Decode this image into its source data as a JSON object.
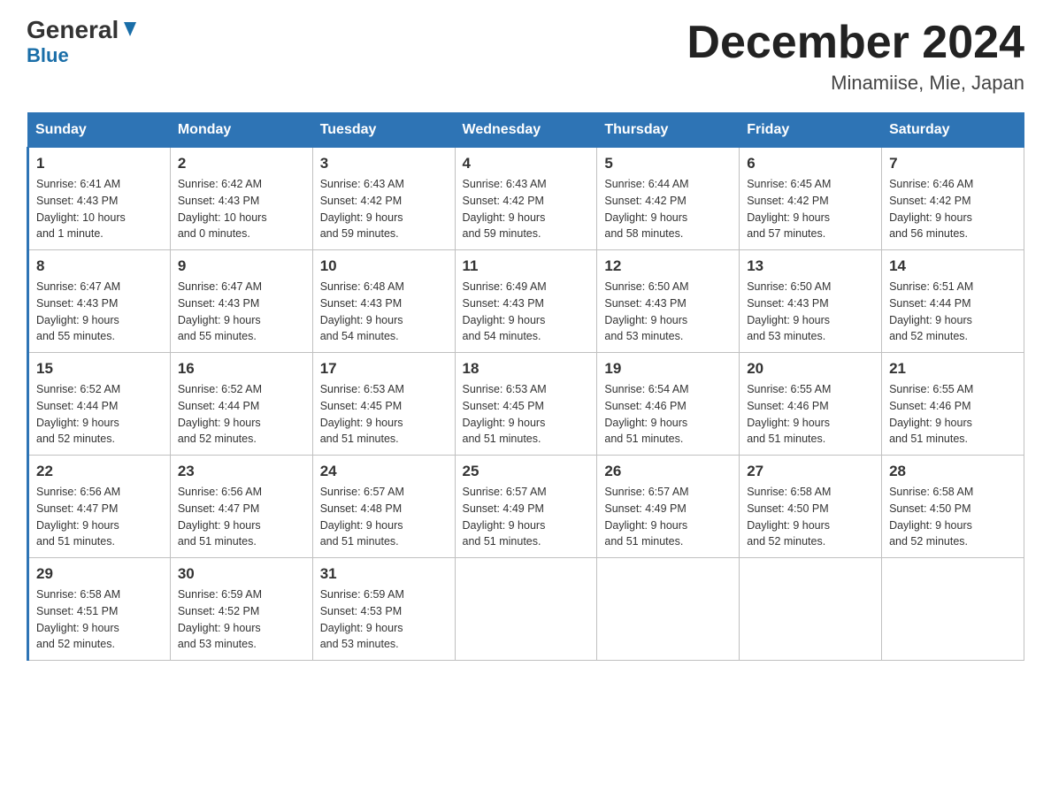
{
  "logo": {
    "part1": "General",
    "part2": "Blue"
  },
  "title": "December 2024",
  "subtitle": "Minamiise, Mie, Japan",
  "days_header": [
    "Sunday",
    "Monday",
    "Tuesday",
    "Wednesday",
    "Thursday",
    "Friday",
    "Saturday"
  ],
  "weeks": [
    [
      {
        "day": "1",
        "info": "Sunrise: 6:41 AM\nSunset: 4:43 PM\nDaylight: 10 hours\nand 1 minute."
      },
      {
        "day": "2",
        "info": "Sunrise: 6:42 AM\nSunset: 4:43 PM\nDaylight: 10 hours\nand 0 minutes."
      },
      {
        "day": "3",
        "info": "Sunrise: 6:43 AM\nSunset: 4:42 PM\nDaylight: 9 hours\nand 59 minutes."
      },
      {
        "day": "4",
        "info": "Sunrise: 6:43 AM\nSunset: 4:42 PM\nDaylight: 9 hours\nand 59 minutes."
      },
      {
        "day": "5",
        "info": "Sunrise: 6:44 AM\nSunset: 4:42 PM\nDaylight: 9 hours\nand 58 minutes."
      },
      {
        "day": "6",
        "info": "Sunrise: 6:45 AM\nSunset: 4:42 PM\nDaylight: 9 hours\nand 57 minutes."
      },
      {
        "day": "7",
        "info": "Sunrise: 6:46 AM\nSunset: 4:42 PM\nDaylight: 9 hours\nand 56 minutes."
      }
    ],
    [
      {
        "day": "8",
        "info": "Sunrise: 6:47 AM\nSunset: 4:43 PM\nDaylight: 9 hours\nand 55 minutes."
      },
      {
        "day": "9",
        "info": "Sunrise: 6:47 AM\nSunset: 4:43 PM\nDaylight: 9 hours\nand 55 minutes."
      },
      {
        "day": "10",
        "info": "Sunrise: 6:48 AM\nSunset: 4:43 PM\nDaylight: 9 hours\nand 54 minutes."
      },
      {
        "day": "11",
        "info": "Sunrise: 6:49 AM\nSunset: 4:43 PM\nDaylight: 9 hours\nand 54 minutes."
      },
      {
        "day": "12",
        "info": "Sunrise: 6:50 AM\nSunset: 4:43 PM\nDaylight: 9 hours\nand 53 minutes."
      },
      {
        "day": "13",
        "info": "Sunrise: 6:50 AM\nSunset: 4:43 PM\nDaylight: 9 hours\nand 53 minutes."
      },
      {
        "day": "14",
        "info": "Sunrise: 6:51 AM\nSunset: 4:44 PM\nDaylight: 9 hours\nand 52 minutes."
      }
    ],
    [
      {
        "day": "15",
        "info": "Sunrise: 6:52 AM\nSunset: 4:44 PM\nDaylight: 9 hours\nand 52 minutes."
      },
      {
        "day": "16",
        "info": "Sunrise: 6:52 AM\nSunset: 4:44 PM\nDaylight: 9 hours\nand 52 minutes."
      },
      {
        "day": "17",
        "info": "Sunrise: 6:53 AM\nSunset: 4:45 PM\nDaylight: 9 hours\nand 51 minutes."
      },
      {
        "day": "18",
        "info": "Sunrise: 6:53 AM\nSunset: 4:45 PM\nDaylight: 9 hours\nand 51 minutes."
      },
      {
        "day": "19",
        "info": "Sunrise: 6:54 AM\nSunset: 4:46 PM\nDaylight: 9 hours\nand 51 minutes."
      },
      {
        "day": "20",
        "info": "Sunrise: 6:55 AM\nSunset: 4:46 PM\nDaylight: 9 hours\nand 51 minutes."
      },
      {
        "day": "21",
        "info": "Sunrise: 6:55 AM\nSunset: 4:46 PM\nDaylight: 9 hours\nand 51 minutes."
      }
    ],
    [
      {
        "day": "22",
        "info": "Sunrise: 6:56 AM\nSunset: 4:47 PM\nDaylight: 9 hours\nand 51 minutes."
      },
      {
        "day": "23",
        "info": "Sunrise: 6:56 AM\nSunset: 4:47 PM\nDaylight: 9 hours\nand 51 minutes."
      },
      {
        "day": "24",
        "info": "Sunrise: 6:57 AM\nSunset: 4:48 PM\nDaylight: 9 hours\nand 51 minutes."
      },
      {
        "day": "25",
        "info": "Sunrise: 6:57 AM\nSunset: 4:49 PM\nDaylight: 9 hours\nand 51 minutes."
      },
      {
        "day": "26",
        "info": "Sunrise: 6:57 AM\nSunset: 4:49 PM\nDaylight: 9 hours\nand 51 minutes."
      },
      {
        "day": "27",
        "info": "Sunrise: 6:58 AM\nSunset: 4:50 PM\nDaylight: 9 hours\nand 52 minutes."
      },
      {
        "day": "28",
        "info": "Sunrise: 6:58 AM\nSunset: 4:50 PM\nDaylight: 9 hours\nand 52 minutes."
      }
    ],
    [
      {
        "day": "29",
        "info": "Sunrise: 6:58 AM\nSunset: 4:51 PM\nDaylight: 9 hours\nand 52 minutes."
      },
      {
        "day": "30",
        "info": "Sunrise: 6:59 AM\nSunset: 4:52 PM\nDaylight: 9 hours\nand 53 minutes."
      },
      {
        "day": "31",
        "info": "Sunrise: 6:59 AM\nSunset: 4:53 PM\nDaylight: 9 hours\nand 53 minutes."
      },
      null,
      null,
      null,
      null
    ]
  ]
}
